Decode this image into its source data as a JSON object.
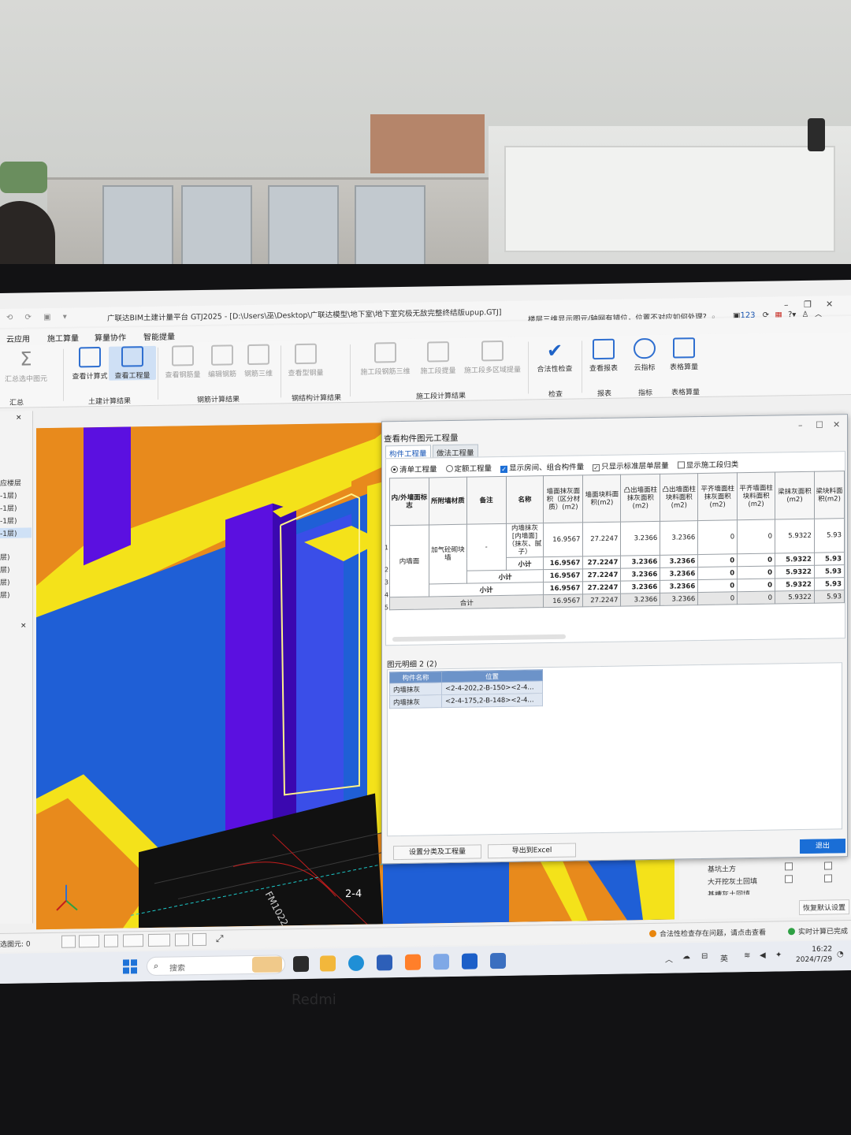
{
  "app": {
    "title": "广联达BIM土建计量平台 GTJ2025 - [D:\\Users\\巫\\Desktop\\广联达模型\\地下室\\地下室究极无敌完整终结版upup.GTJ]",
    "help_text": "楼层三维显示图元/轴网有错位，位置不对应如何处理?",
    "badge_count": "123"
  },
  "menu": {
    "tabs": [
      "云应用",
      "施工算量",
      "算量协作",
      "智能提量"
    ]
  },
  "ribbon": {
    "buttons": {
      "b0": "汇总选中图元",
      "b1": "查看计算式",
      "b2": "查看工程量",
      "b3": "查看钢筋量",
      "b4": "编辑钢筋",
      "b5": "钢筋三维",
      "b6": "查看型钢量",
      "b7": "施工段钢筋三维",
      "b8": "施工段提量",
      "b9": "施工段多区域提量",
      "b10": "合法性检查",
      "b11": "查看报表",
      "b12": "云指标",
      "b13": "表格算量"
    },
    "groups": {
      "g0": "汇总",
      "g1": "土建计算结果",
      "g2": "钢筋计算结果",
      "g3": "钢结构计算结果",
      "g4": "施工段计算结果",
      "g5": "检查",
      "g6": "报表",
      "g7": "指标",
      "g8": "表格算量"
    }
  },
  "left_panel": {
    "items": [
      "应楼层",
      "-1层)",
      "-1层)",
      "-1层)",
      "-1层)",
      "层)",
      "层)",
      "层)",
      "层)"
    ]
  },
  "dialog": {
    "title": "查看构件图元工程量",
    "tabs": [
      "构件工程量",
      "做法工程量"
    ],
    "options": {
      "o1": "清单工程量",
      "o2": "定额工程量",
      "o3": "显示房间、组合构件量",
      "o4": "只显示标准层单层量",
      "o5": "显示施工段归类"
    },
    "table": {
      "headers": {
        "h0": "内/外墙面标志",
        "h1": "所附墙材质",
        "h2": "备注",
        "h3": "名称",
        "h4": "墙面抹灰面积（区分材质）(m2)",
        "h5": "墙面块料面积(m2)",
        "h6": "凸出墙面柱抹灰面积(m2)",
        "h7": "凸出墙面柱块料面积(m2)",
        "h8": "平齐墙面柱抹灰面积(m2)",
        "h9": "平齐墙面柱块料面积(m2)",
        "h10": "梁抹灰面积(m2)",
        "h11": "梁块料面积(m2)"
      },
      "row_numbers": [
        "1",
        "2",
        "3",
        "4",
        "5"
      ],
      "c_wall": "内墙面",
      "c_mat": "加气砼砌块墙",
      "c_note": "-",
      "c_name": "内墙抹灰[内墙面]（抹灰、腻子）",
      "subtotal": "小计",
      "total": "合计",
      "r1": {
        "a": "16.9567",
        "b": "27.2247",
        "c": "3.2366",
        "d": "3.2366",
        "e": "0",
        "f": "0",
        "g": "5.9322",
        "h": "5.93"
      },
      "r2": {
        "a": "16.9567",
        "b": "27.2247",
        "c": "3.2366",
        "d": "3.2366",
        "e": "0",
        "f": "0",
        "g": "5.9322",
        "h": "5.93"
      },
      "r3": {
        "a": "16.9567",
        "b": "27.2247",
        "c": "3.2366",
        "d": "3.2366",
        "e": "0",
        "f": "0",
        "g": "5.9322",
        "h": "5.93"
      },
      "r4": {
        "a": "16.9567",
        "b": "27.2247",
        "c": "3.2366",
        "d": "3.2366",
        "e": "0",
        "f": "0",
        "g": "5.9322",
        "h": "5.93"
      },
      "r5": {
        "a": "16.9567",
        "b": "27.2247",
        "c": "3.2366",
        "d": "3.2366",
        "e": "0",
        "f": "0",
        "g": "5.9322",
        "h": "5.93"
      }
    },
    "detail_label": "图元明细  2 (2)",
    "detail": {
      "h_name": "构件名称",
      "h_pos": "位置",
      "rows": [
        {
          "name": "内墙抹灰",
          "pos": "<2-4-202,2-B-150><2-4..."
        },
        {
          "name": "内墙抹灰",
          "pos": "<2-4-175,2-B-148><2-4..."
        }
      ]
    },
    "buttons": {
      "set_class": "设置分类及工程量",
      "export": "导出到Excel",
      "exit": "退出"
    }
  },
  "right_panel": {
    "items": [
      "基坑土方",
      "大开挖灰土回填",
      "基槽灰土回填"
    ],
    "restore": "恢复默认设置"
  },
  "viewport": {
    "grid_label": "2-4",
    "door_label": "FM1022"
  },
  "status": {
    "selected": "选图元: 0",
    "warning": "合法性检查存在问题，请点击查看",
    "realtime": "实时计算已完成"
  },
  "taskbar": {
    "search": "搜索",
    "ime": "英",
    "time": "16:22",
    "date": "2024/7/29"
  },
  "monitor": {
    "brand": "Redmi"
  },
  "colors": {
    "accent_blue": "#1a6ed6",
    "wall_blue": "#1f5fd6",
    "column_purple": "#5b10e0",
    "slab_orange": "#e88a1c",
    "edge_yellow": "#f4e21a"
  }
}
